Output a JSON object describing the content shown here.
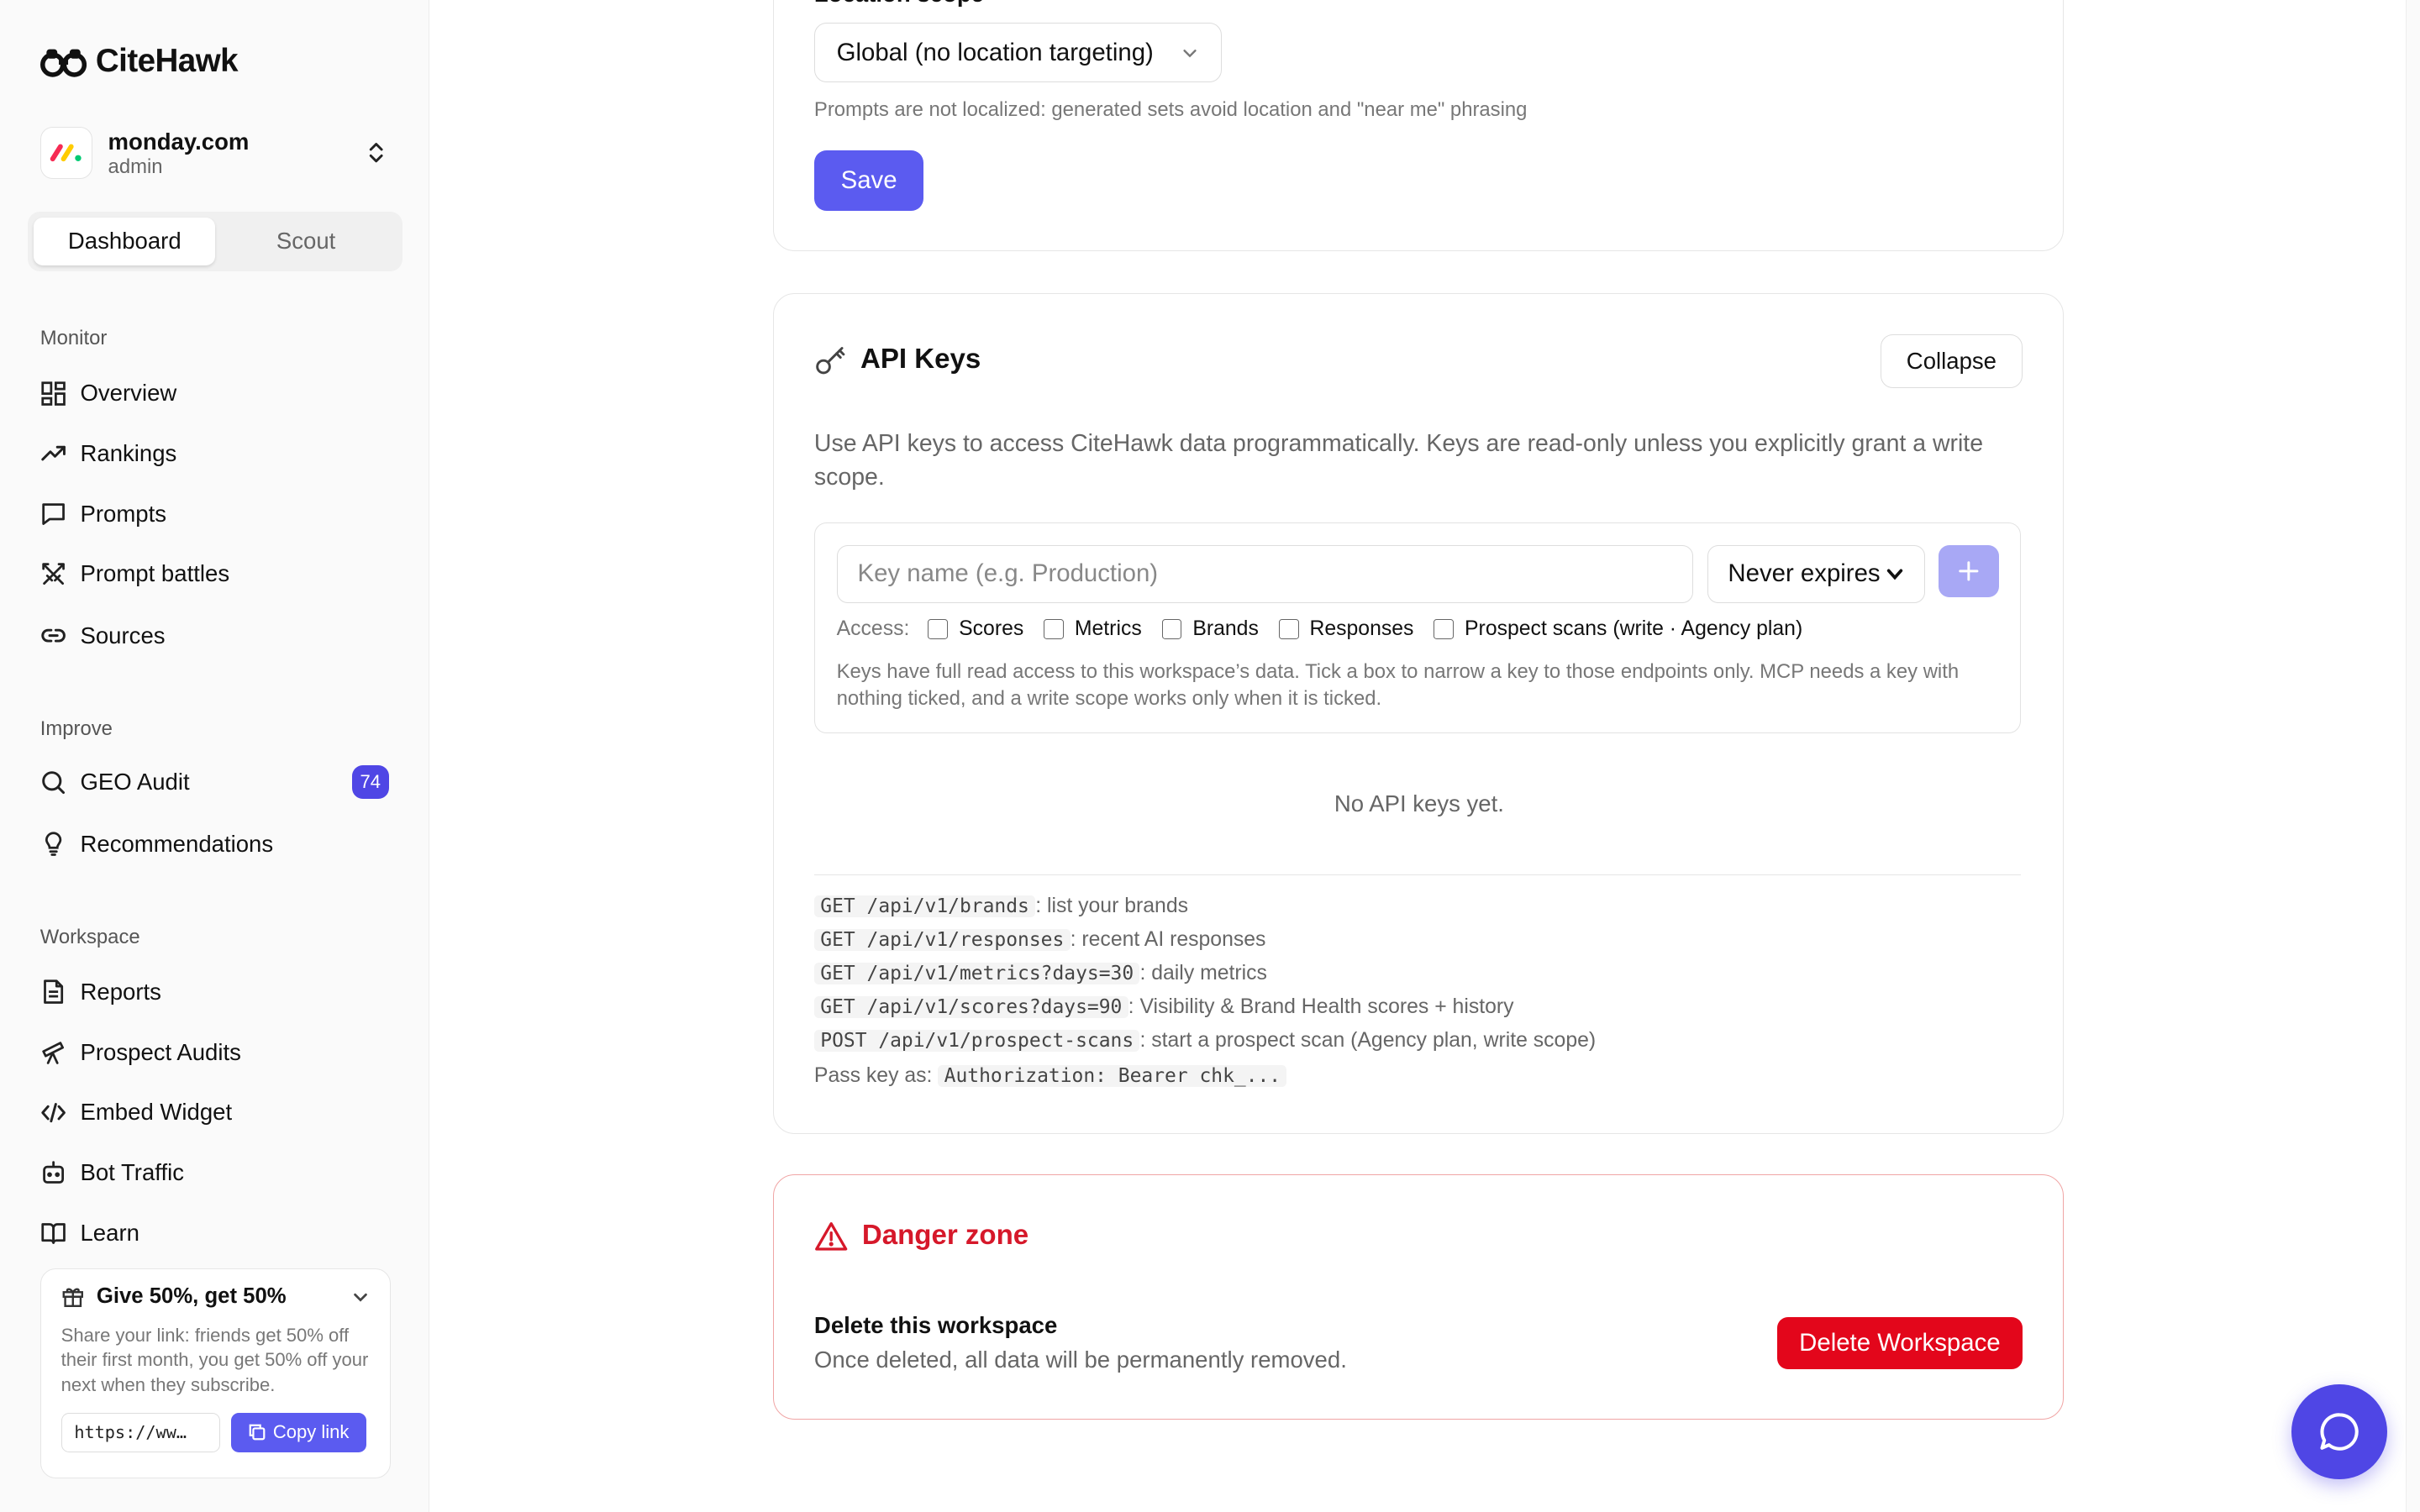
{
  "app": {
    "name": "CiteHawk"
  },
  "workspace": {
    "name": "monday.com",
    "role": "admin"
  },
  "mode_tabs": [
    "Dashboard",
    "Scout"
  ],
  "sidebar": {
    "monitor_label": "Monitor",
    "monitor": [
      {
        "label": "Overview",
        "icon": "grid-icon"
      },
      {
        "label": "Rankings",
        "icon": "trending-up-icon"
      },
      {
        "label": "Prompts",
        "icon": "message-square-icon"
      },
      {
        "label": "Prompt battles",
        "icon": "swords-icon"
      },
      {
        "label": "Sources",
        "icon": "link-icon"
      }
    ],
    "improve_label": "Improve",
    "improve": [
      {
        "label": "GEO Audit",
        "icon": "search-icon",
        "badge": "74"
      },
      {
        "label": "Recommendations",
        "icon": "lightbulb-icon"
      }
    ],
    "workspace_label": "Workspace",
    "workspace_items": [
      {
        "label": "Reports",
        "icon": "file-text-icon"
      },
      {
        "label": "Prospect Audits",
        "icon": "telescope-icon"
      },
      {
        "label": "Embed Widget",
        "icon": "code-icon"
      },
      {
        "label": "Bot Traffic",
        "icon": "bot-icon"
      },
      {
        "label": "Learn",
        "icon": "book-open-icon"
      }
    ],
    "promo": {
      "title": "Give 50%, get 50%",
      "desc": "Share your link: friends get 50% off their first month, you get 50% off your next when they subscribe.",
      "link": "https://ww…",
      "copy_label": "Copy link"
    }
  },
  "location": {
    "label": "Location scope",
    "value": "Global (no location targeting)",
    "hint": "Prompts are not localized: generated sets avoid location and \"near me\" phrasing",
    "save_label": "Save"
  },
  "api": {
    "title": "API Keys",
    "collapse_label": "Collapse",
    "desc": "Use API keys to access CiteHawk data programmatically. Keys are read-only unless you explicitly grant a write scope.",
    "key_placeholder": "Key name (e.g. Production)",
    "expires_value": "Never expires",
    "access_label": "Access:",
    "scopes": [
      "Scores",
      "Metrics",
      "Brands",
      "Responses",
      "Prospect scans (write · Agency plan)"
    ],
    "note": "Keys have full read access to this workspace’s data. Tick a box to narrow a key to those endpoints only. MCP needs a key with nothing ticked, and a write scope works only when it is ticked.",
    "empty": "No API keys yet.",
    "endpoints": [
      {
        "code": "GET /api/v1/brands",
        "desc": ": list your brands"
      },
      {
        "code": "GET /api/v1/responses",
        "desc": ": recent AI responses"
      },
      {
        "code": "GET /api/v1/metrics?days=30",
        "desc": ": daily metrics"
      },
      {
        "code": "GET /api/v1/scores?days=90",
        "desc": ": Visibility & Brand Health scores + history"
      },
      {
        "code": "POST /api/v1/prospect-scans",
        "desc": ": start a prospect scan (Agency plan, write scope)"
      }
    ],
    "pass_label": "Pass key as:",
    "pass_code": "Authorization: Bearer chk_..."
  },
  "danger": {
    "title": "Danger zone",
    "delete_title": "Delete this workspace",
    "delete_desc": "Once deleted, all data will be permanently removed.",
    "delete_label": "Delete Workspace"
  },
  "colors": {
    "accent": "#5b5bf0",
    "badge": "#4f46e5",
    "danger": "#e3061b"
  }
}
